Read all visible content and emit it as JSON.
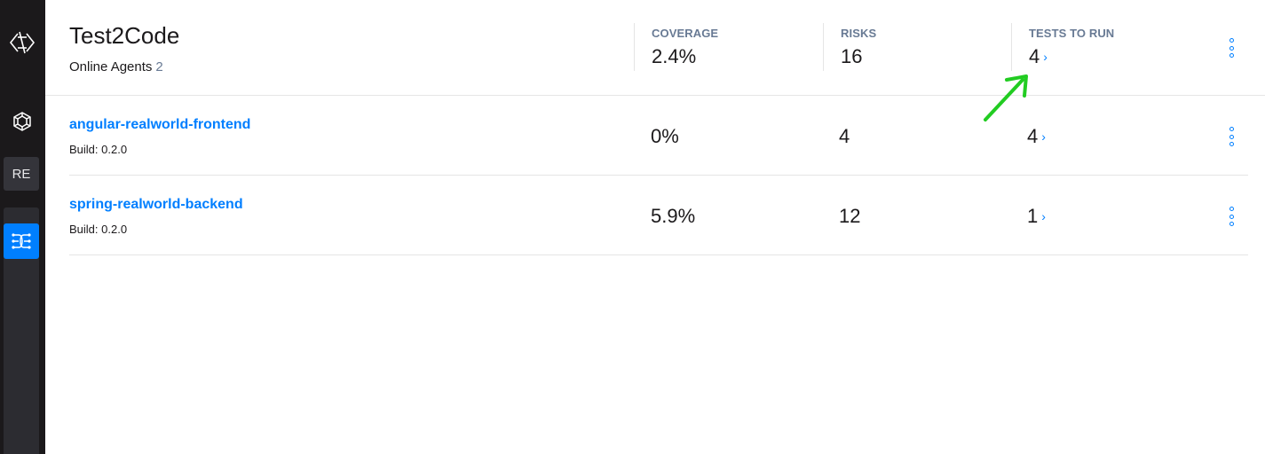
{
  "sidebar": {
    "items": [
      {
        "name": "logo-icon"
      },
      {
        "name": "cube-icon"
      },
      {
        "label": "RE"
      },
      {
        "name": "test2code-plugin-icon"
      }
    ]
  },
  "header": {
    "title": "Test2Code",
    "online_agents_label": "Online Agents",
    "online_agents_count": "2",
    "stats": {
      "coverage": {
        "label": "COVERAGE",
        "value": "2.4%"
      },
      "risks": {
        "label": "RISKS",
        "value": "16"
      },
      "tests_to_run": {
        "label": "TESTS TO RUN",
        "value": "4"
      }
    }
  },
  "agents": [
    {
      "name": "angular-realworld-frontend",
      "build": "Build: 0.2.0",
      "coverage": "0%",
      "risks": "4",
      "tests_to_run": "4"
    },
    {
      "name": "spring-realworld-backend",
      "build": "Build: 0.2.0",
      "coverage": "5.9%",
      "risks": "12",
      "tests_to_run": "1"
    }
  ],
  "colors": {
    "accent": "#007fff",
    "sidebar_bg": "#1b191b",
    "muted": "#687a94",
    "annotation": "#22cc22"
  }
}
